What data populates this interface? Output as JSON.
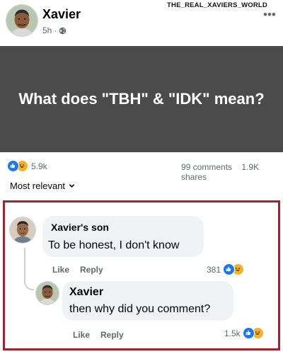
{
  "watermark": "THE_REAL_XAVIERS_WORLD",
  "post": {
    "author": "Xavier",
    "time": "5h",
    "separator": "·",
    "privacy_icon": "globe-icon",
    "more_icon": "more-options-icon",
    "more_glyph": "•••",
    "banner_text": "What does \"TBH\" & \"IDK\" mean?",
    "banner_color": "#4b4b4b"
  },
  "stats": {
    "reaction_icons": [
      "like-reaction-icon",
      "haha-reaction-icon"
    ],
    "reactions": "5.9k",
    "comments": "99 comments",
    "shares": "1.9K shares"
  },
  "sort": {
    "label": "Most relevant",
    "icon": "chevron-down-icon"
  },
  "highlight_color": "#a3222c",
  "comments": [
    {
      "author": "Xavier's son",
      "text": "To be honest, I don't know",
      "like_label": "Like",
      "reply_label": "Reply",
      "reaction_count": "381"
    },
    {
      "author": "Xavier",
      "text": "then why did you comment?",
      "like_label": "Like",
      "reply_label": "Reply",
      "reaction_count": "1.5k"
    }
  ]
}
